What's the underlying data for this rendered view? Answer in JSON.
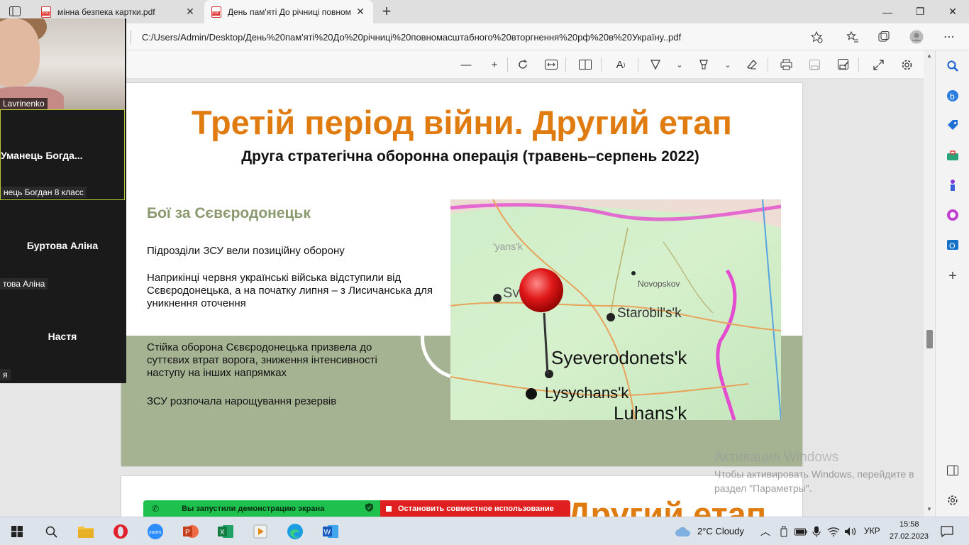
{
  "browser": {
    "tabs": [
      {
        "title": "мінна безпека картки.pdf",
        "close": "✕"
      },
      {
        "title": "День пам'яті До річниці повном",
        "close": "✕"
      }
    ],
    "new_tab": "+",
    "address": "C:/Users/Admin/Desktop/День%20пам'яті%20До%20річниці%20повномасштабного%20вторгнення%20рф%20в%20Україну..pdf",
    "window_controls": {
      "minimize": "—",
      "restore": "❐",
      "close": "✕"
    }
  },
  "slide": {
    "title": "Третій період війни. Другий етап",
    "subtitle": "Друга стратегічна оборонна операція (травень–серпень 2022)",
    "heading": "Бої за Сєвєродонецьк",
    "paragraphs": [
      "Підрозділи ЗСУ вели позиційну оборону",
      "Наприкінці червня українські війська відступили від Сєвєродонецька, а на початку липня – з Лисичанська для уникнення оточення",
      "Стійка оборона Сєвєродонецька призвела до суттєвих втрат ворога, зниження інтенсивності наступу на інших напрямках",
      "ЗСУ розпочала нарощування резервів"
    ],
    "map_labels": {
      "city1": "Syeverodonets'k",
      "city2": "Lysychans'k",
      "city3": "Starobil's'k",
      "city4": "Novopskov",
      "city5": "Luhans'k",
      "city6": "'yans'k",
      "city7": "Sv"
    }
  },
  "slide2": {
    "title_fragment": "Другий етап"
  },
  "watermark": {
    "line1": "Активация Windows",
    "line2": "Чтобы активировать Windows, перейдите в раздел \"Параметры\"."
  },
  "zoom": {
    "participants": [
      {
        "name": "Lavrinenko"
      },
      {
        "name": "Уманець  Богда...",
        "chip": "нець Богдан 8 класс"
      },
      {
        "name": "Буртова Аліна",
        "chip": "това Аліна"
      },
      {
        "name": "Настя",
        "chip": "я"
      }
    ],
    "sharing_text": "Вы запустили демонстрацию экрана",
    "stop_text": "Остановить совместное использование"
  },
  "taskbar": {
    "weather": "2°C  Cloudy",
    "lang": "УКР",
    "time": "15:58",
    "date": "27.02.2023"
  },
  "colors": {
    "title_orange": "#e07b0f",
    "heading_green": "#8a9a6f",
    "band_green": "#a6b393",
    "share_green": "#1ec14e",
    "share_red": "#e02020"
  }
}
